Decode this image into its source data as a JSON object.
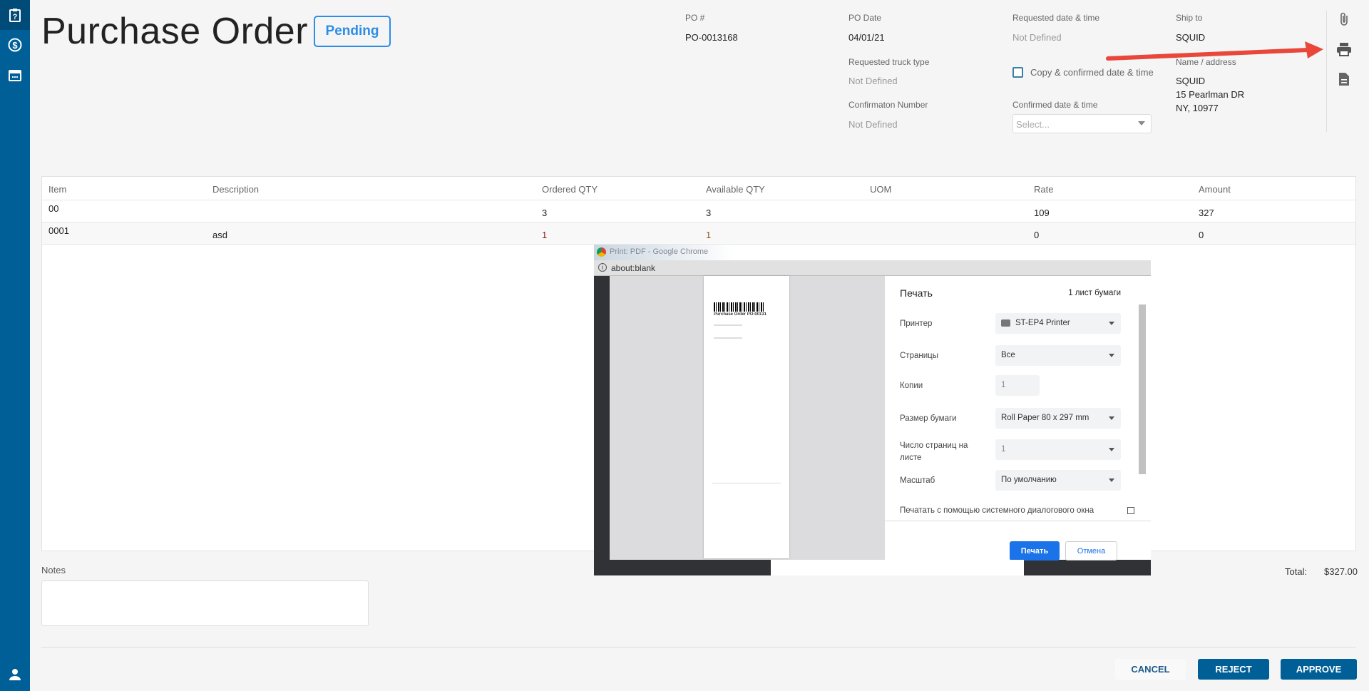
{
  "header": {
    "title": "Purchase Order",
    "status": "Pending"
  },
  "fields": {
    "po_number_label": "PO #",
    "po_number": "PO-0013168",
    "po_date_label": "PO Date",
    "po_date": "04/01/21",
    "requested_dt_label": "Requested date & time",
    "requested_dt": "Not Defined",
    "ship_to_label": "Ship to",
    "ship_to": "SQUID",
    "truck_type_label": "Requested truck type",
    "truck_type": "Not Defined",
    "copy_confirmed_label": "Copy & confirmed date & time",
    "name_address_label": "Name / address",
    "name": "SQUID",
    "address1": "15 Pearlman DR",
    "address2": "NY, 10977",
    "confirmation_label": "Confirmaton Number",
    "confirmation": "Not Defined",
    "confirmed_dt_label": "Confirmed date & time",
    "confirmed_dt_placeholder": "Select..."
  },
  "table": {
    "columns": [
      "Item",
      "Description",
      "Ordered QTY",
      "Available QTY",
      "UOM",
      "Rate",
      "Amount"
    ],
    "rows": [
      [
        "00",
        "",
        "3",
        "3",
        "",
        "109",
        "327"
      ],
      [
        "0001",
        "asd",
        "1",
        "1",
        "",
        "0",
        "0"
      ]
    ]
  },
  "notes_label": "Notes",
  "total_label": "Total:",
  "total_value": "$327.00",
  "buttons": {
    "cancel": "CANCEL",
    "reject": "REJECT",
    "approve": "APPROVE"
  },
  "print_window": {
    "title": "Print: PDF - Google Chrome",
    "address": "about:blank",
    "heading": "Печать",
    "sheets": "1 лист бумаги",
    "preview_title": "Purchase Order PO-00131",
    "rows": [
      {
        "label": "Принтер",
        "value": "ST-EP4 Printer"
      },
      {
        "label": "Страницы",
        "value": "Все"
      },
      {
        "label": "Копии",
        "value": "1"
      },
      {
        "label": "Размер бумаги",
        "value": "Roll Paper 80 x 297 mm"
      },
      {
        "label": "Число страниц на листе",
        "value": "1"
      },
      {
        "label": "Масштаб",
        "value": "По умолчанию"
      }
    ],
    "system_dialog": "Печатать с помощью системного диалогового окна (Ctrl+Shift+P)",
    "print_button": "Печать",
    "cancel_button": "Отмена"
  },
  "colors": {
    "sidebar": "#005f96",
    "accent": "#2b8de8",
    "arrow": "#e8473a"
  }
}
